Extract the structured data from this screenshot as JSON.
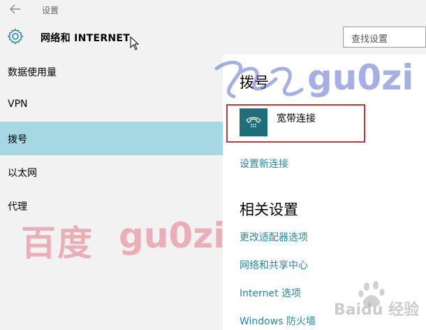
{
  "titlebar": {
    "title": "设置"
  },
  "header": {
    "title": "网络和 INTERNET",
    "search_placeholder": "查找设置"
  },
  "sidebar": {
    "items": [
      {
        "label": "数据使用量"
      },
      {
        "label": "VPN"
      },
      {
        "label": "拨号"
      },
      {
        "label": "以太网"
      },
      {
        "label": "代理"
      }
    ],
    "selected": "拨号"
  },
  "main": {
    "section_title": "拨号",
    "connection": {
      "label": "宽带连接",
      "icon": "dialup-phone-icon"
    },
    "setup_link": "设置新连接",
    "related_title": "相关设置",
    "related_links": [
      {
        "label": "更改适配器选项"
      },
      {
        "label": "网络和共享中心"
      },
      {
        "label": "Internet 选项"
      },
      {
        "label": "Windows 防火墙"
      }
    ]
  },
  "watermarks": {
    "red_text_1": "百度",
    "red_text_2": "gu0zi",
    "blue_text": "gu0zi",
    "logo_text": "Baidu 经验"
  },
  "colors": {
    "accent": "#1e8ba2",
    "selected_bg": "#a6d8e3",
    "tile": "#1e6f7a",
    "highlight_border": "#c0393b"
  }
}
